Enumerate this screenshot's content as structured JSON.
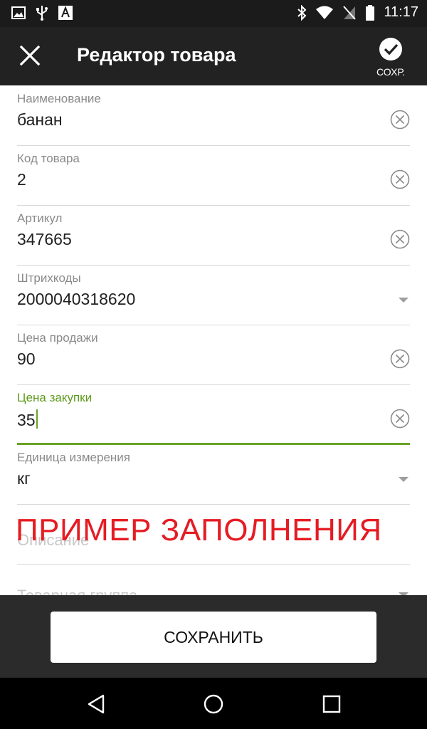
{
  "status_bar": {
    "time": "11:17",
    "left_icons": [
      "image-icon",
      "usb-icon",
      "font-icon"
    ],
    "right_icons": [
      "bluetooth-icon",
      "wifi-icon",
      "no-sim-icon",
      "battery-icon"
    ]
  },
  "toolbar": {
    "title": "Редактор товара",
    "save_label": "СОХР."
  },
  "fields": [
    {
      "label": "Наименование",
      "value": "банан",
      "control": "clear"
    },
    {
      "label": "Код товара",
      "value": "2",
      "control": "clear"
    },
    {
      "label": "Артикул",
      "value": "347665",
      "control": "clear"
    },
    {
      "label": "Штрихкоды",
      "value": "2000040318620",
      "control": "dropdown"
    },
    {
      "label": "Цена продажи",
      "value": "90",
      "control": "clear"
    },
    {
      "label": "Цена закупки",
      "value": "35",
      "control": "clear",
      "focused": true
    },
    {
      "label": "Единица измерения",
      "value": "кг",
      "control": "dropdown"
    },
    {
      "label": "Описание",
      "value": "",
      "control": "none"
    },
    {
      "label": "Товарная группа",
      "value": "",
      "control": "dropdown"
    }
  ],
  "watermark": "ПРИМЕР ЗАПОЛНЕНИЯ",
  "bottom": {
    "save_button_label": "СОХРАНИТЬ"
  },
  "colors": {
    "accent": "#6aa226",
    "watermark": "#e51c23",
    "toolbar": "#222222"
  }
}
